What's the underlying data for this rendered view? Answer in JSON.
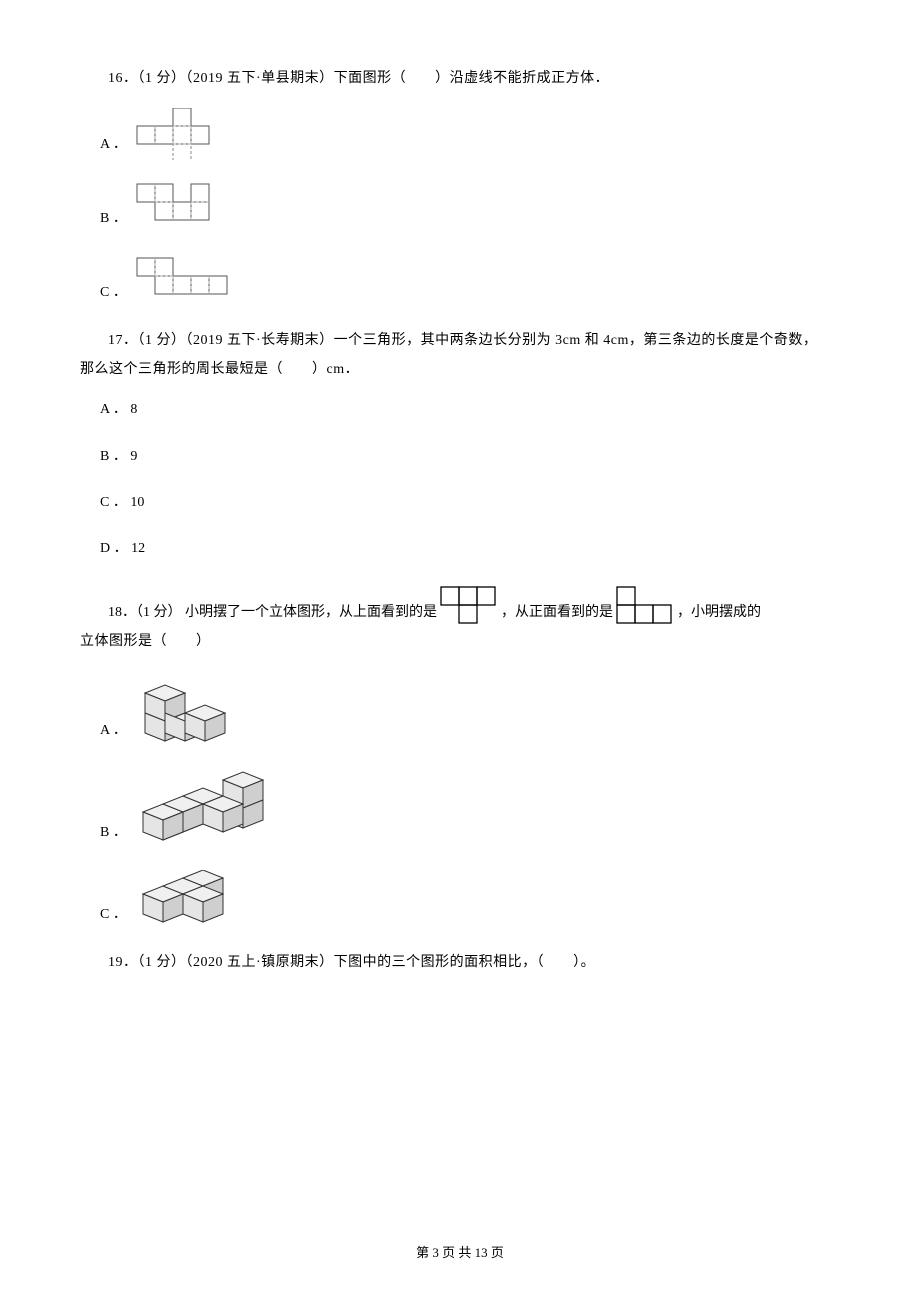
{
  "q16": {
    "prefix": "16．（1 分）（2019 五下·单县期末）下面图形（　　）沿虚线不能折成正方体．",
    "labelA": "A ．",
    "labelB": "B ．",
    "labelC": "C ．"
  },
  "q17": {
    "line1": "17．（1 分）（2019 五下·长寿期末）一个三角形，其中两条边长分别为 3cm 和 4cm，第三条边的长度是个奇数，",
    "line2": "那么这个三角形的周长最短是（　　）cm．",
    "optA": "A ． 8",
    "optB": "B ． 9",
    "optC": "C ． 10",
    "optD": "D ． 12"
  },
  "q18": {
    "seg1": "18．（1 分） 小明摆了一个立体图形，从上面看到的是",
    "seg2": " ，从正面看到的是",
    "seg3": " ，小明摆成的",
    "line2": "立体图形是（　　）",
    "labelA": "A ．",
    "labelB": "B ．",
    "labelC": "C ．"
  },
  "q19": {
    "text": "19．（1 分）（2020 五上·镇原期末）下图中的三个图形的面积相比，（　　）。"
  },
  "footer": "第 3 页 共 13 页"
}
